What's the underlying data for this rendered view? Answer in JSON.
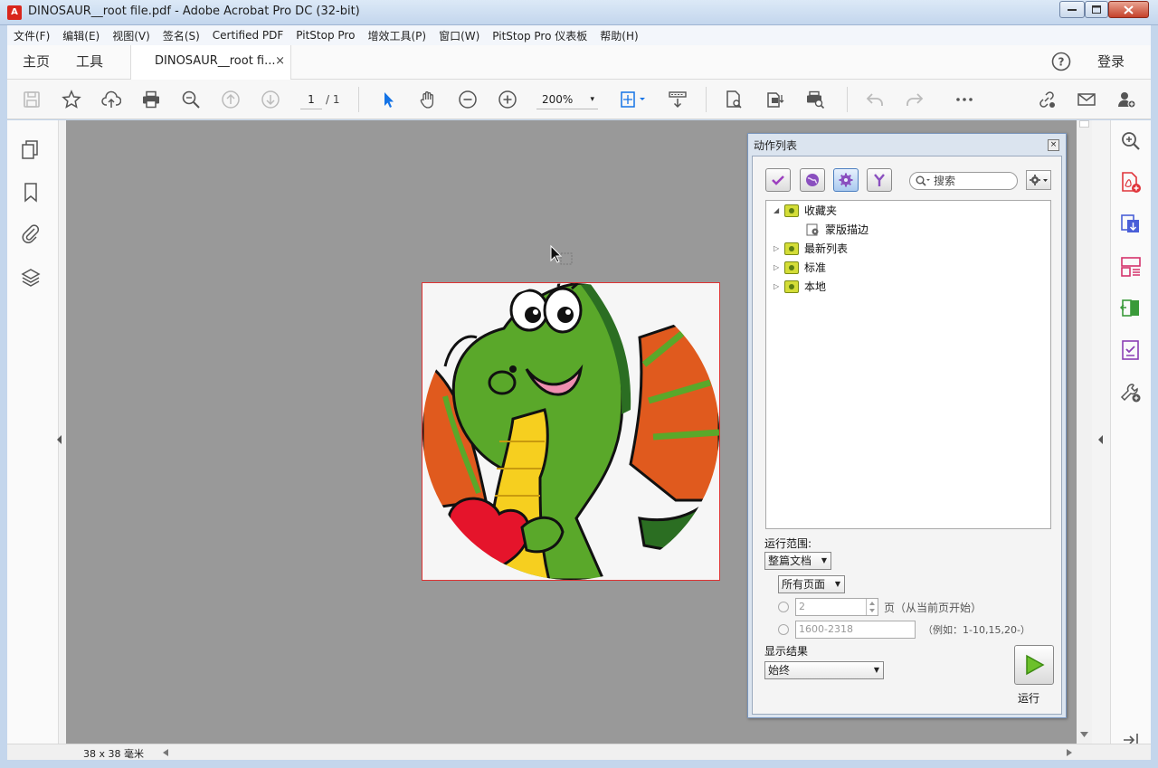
{
  "window": {
    "title": "DINOSAUR__root file.pdf - Adobe Acrobat Pro DC (32-bit)",
    "app_icon_letter": "A"
  },
  "menu": [
    "文件(F)",
    "编辑(E)",
    "视图(V)",
    "签名(S)",
    "Certified PDF",
    "PitStop Pro",
    "增效工具(P)",
    "窗口(W)",
    "PitStop Pro 仪表板",
    "帮助(H)"
  ],
  "tabs": {
    "home": "主页",
    "tools": "工具",
    "document": "DINOSAUR__root fi...",
    "close": "×",
    "signin": "登录"
  },
  "toolbar": {
    "page_current": "1",
    "page_total": "/ 1",
    "zoom": "200%",
    "zoom_arrow": "▾"
  },
  "status": {
    "page_size": "38 x 38 毫米"
  },
  "action_panel": {
    "title": "动作列表",
    "close": "×",
    "search_placeholder": "搜索",
    "tree": [
      {
        "label": "收藏夹",
        "expanded": true,
        "arrow": "◢"
      },
      {
        "label": "蒙版描边",
        "child": true
      },
      {
        "label": "最新列表",
        "arrow": "▷"
      },
      {
        "label": "标准",
        "arrow": "▷"
      },
      {
        "label": "本地",
        "arrow": "▷"
      }
    ],
    "run_scope_label": "运行范围:",
    "scope_select": "整篇文档",
    "pages_select": "所有页面",
    "page_count_value": "2",
    "page_count_suffix": "页（从当前页开始）",
    "range_value": "1600-2318",
    "range_hint": "（例如：1-10,15,20-）",
    "show_result_label": "显示结果",
    "show_result_select": "始终",
    "run_label": "运行",
    "combo_arrow": "▼"
  },
  "colors": {
    "accent": "#1473e6",
    "doc_bg": "#999999",
    "titlebar": "#c4d6ec"
  }
}
